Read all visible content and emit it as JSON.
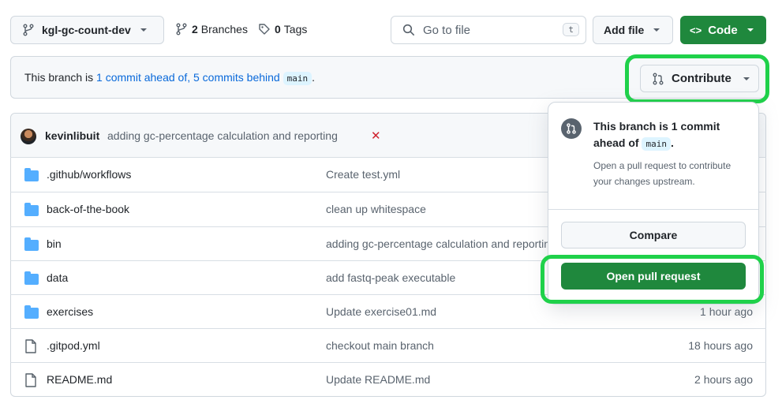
{
  "toolbar": {
    "branch_name": "kgl-gc-count-dev",
    "branches_count": "2",
    "branches_label": "Branches",
    "tags_count": "0",
    "tags_label": "Tags",
    "search_placeholder": "Go to file",
    "search_shortcut": "t",
    "add_file_label": "Add file",
    "code_label": "Code"
  },
  "compare_bar": {
    "prefix": "This branch is ",
    "ahead_link": "1 commit ahead of,",
    "behind_link": "5 commits behind",
    "base_branch": "main",
    "suffix": ".",
    "contribute_label": "Contribute"
  },
  "commit": {
    "author": "kevinlibuit",
    "message": "adding gc-percentage calculation and reporting",
    "status": "✕"
  },
  "files": [
    {
      "type": "folder",
      "name": ".github/workflows",
      "message": "Create test.yml",
      "age": ""
    },
    {
      "type": "folder",
      "name": "back-of-the-book",
      "message": "clean up whitespace",
      "age": ""
    },
    {
      "type": "folder",
      "name": "bin",
      "message": "adding gc-percentage calculation and reporting",
      "age": ""
    },
    {
      "type": "folder",
      "name": "data",
      "message": "add fastq-peak executable",
      "age": ""
    },
    {
      "type": "folder",
      "name": "exercises",
      "message": "Update exercise01.md",
      "age": "1 hour ago"
    },
    {
      "type": "file",
      "name": ".gitpod.yml",
      "message": "checkout main branch",
      "age": "18 hours ago"
    },
    {
      "type": "file",
      "name": "README.md",
      "message": "Update README.md",
      "age": "2 hours ago"
    }
  ],
  "popover": {
    "title_line1": "This branch is 1 commit",
    "title_line2": "ahead of",
    "title_branch": "main",
    "title_period": ".",
    "description": "Open a pull request to contribute your changes upstream.",
    "compare_label": "Compare",
    "open_pr_label": "Open pull request"
  },
  "colors": {
    "primary_green": "#1f883d",
    "highlight_green": "#1fd14a",
    "link_blue": "#0969da",
    "folder_blue": "#54aeff",
    "error_red": "#cf222e"
  }
}
